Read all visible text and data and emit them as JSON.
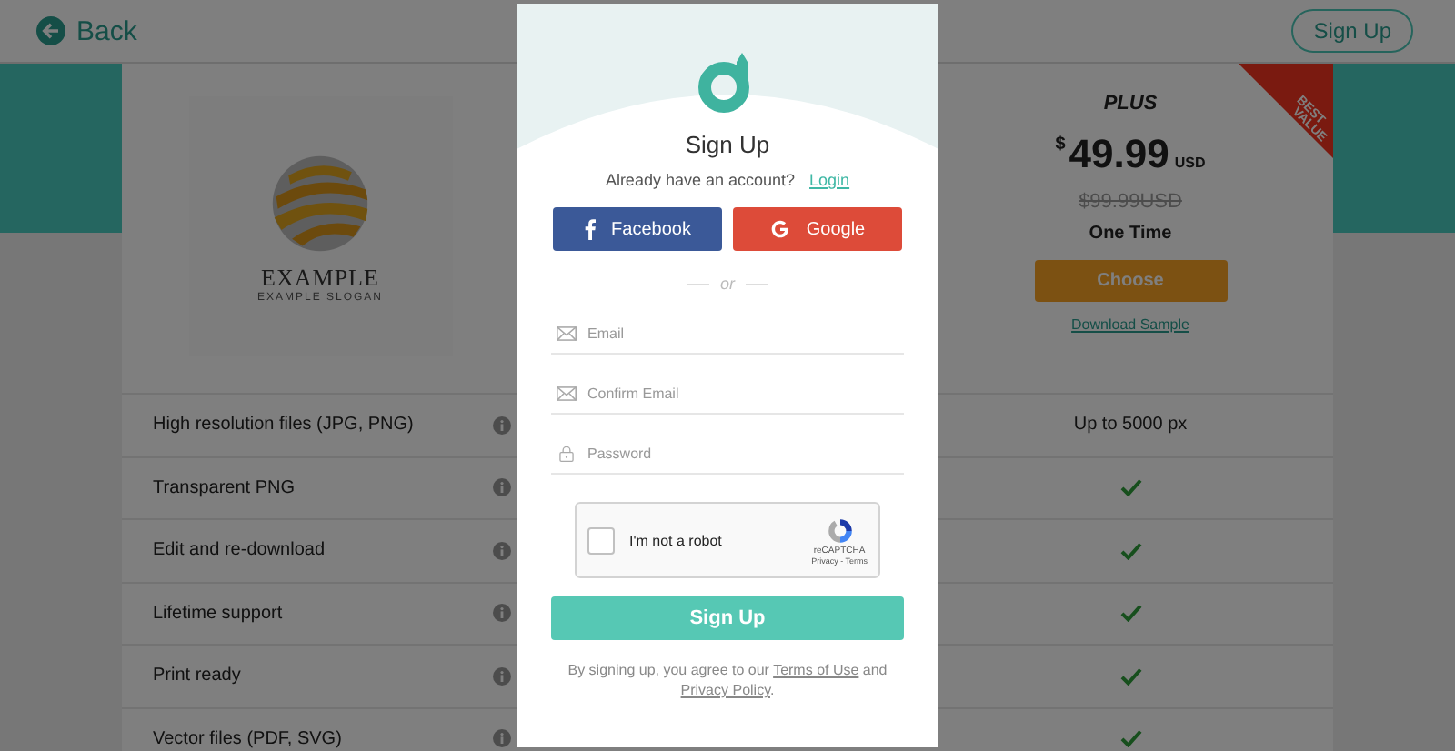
{
  "header": {
    "back": "Back",
    "signup": "Sign Up"
  },
  "product": {
    "logo_title": "EXAMPLE",
    "logo_slogan": "EXAMPLE SLOGAN"
  },
  "plan": {
    "ribbon": [
      "BEST",
      "VALUE"
    ],
    "name": "PLUS",
    "currency": "$",
    "price": "49.99",
    "unit": "USD",
    "old_price": "$99.99USD",
    "term": "One Time",
    "choose": "Choose",
    "sample": "Download Sample"
  },
  "features": [
    {
      "label": "High resolution files (JPG, PNG)",
      "kind": "text",
      "value": "Up to 5000 px"
    },
    {
      "label": "Transparent PNG",
      "kind": "check",
      "included": true
    },
    {
      "label": "Edit and re-download",
      "kind": "check",
      "included": true
    },
    {
      "label": "Lifetime support",
      "kind": "check",
      "included": true
    },
    {
      "label": "Print ready",
      "kind": "check",
      "included": true
    },
    {
      "label": "Vector files (PDF, SVG)",
      "kind": "check",
      "included": true
    }
  ],
  "modal": {
    "title": "Sign Up",
    "prompt": "Already have an account?",
    "login": "Login",
    "social": [
      {
        "kind": "facebook",
        "label": "Facebook"
      },
      {
        "kind": "google",
        "label": "Google"
      }
    ],
    "divider": "or",
    "fields": [
      {
        "kind": "email",
        "placeholder": "Email"
      },
      {
        "kind": "email",
        "placeholder": "Confirm Email"
      },
      {
        "kind": "password",
        "placeholder": "Password"
      }
    ],
    "captcha": {
      "label": "I'm not a robot",
      "checked": false,
      "brand": "reCAPTCHA",
      "links": "Privacy - Terms"
    },
    "submit": "Sign Up",
    "legal": {
      "before": "By signing up, you agree to our",
      "terms": "Terms of Use",
      "middle": "and",
      "privacy": "Privacy Policy",
      "after": "."
    }
  }
}
